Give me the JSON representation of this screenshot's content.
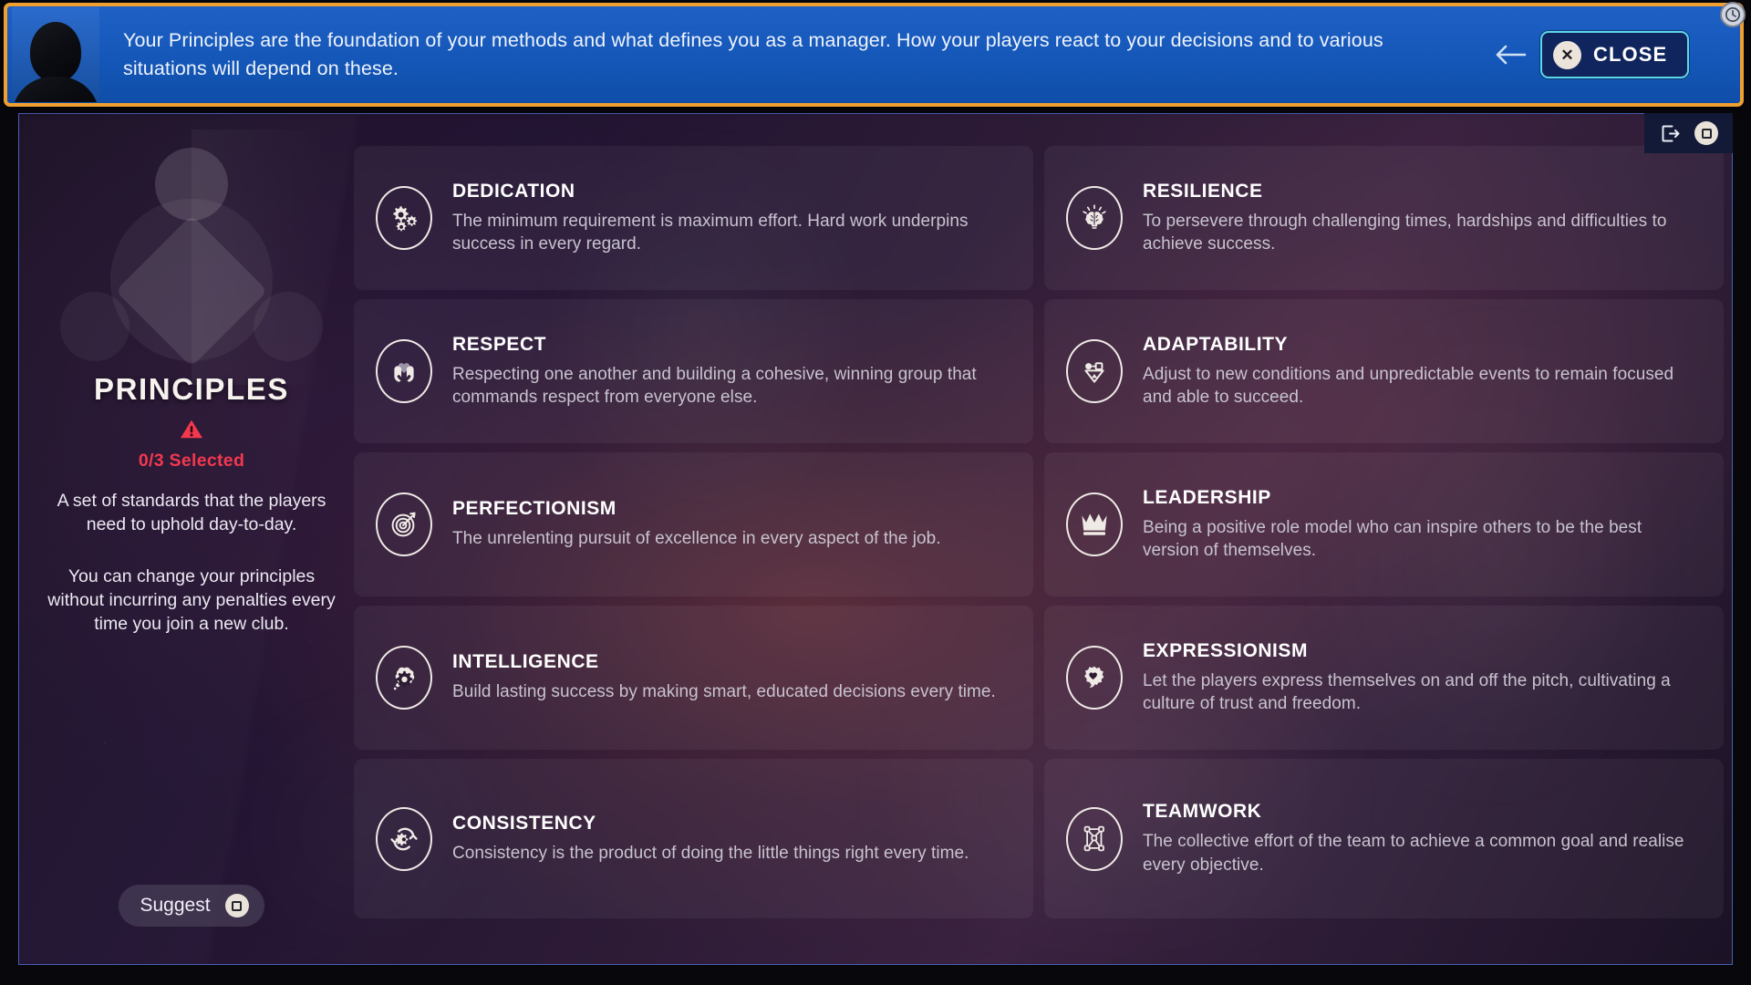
{
  "banner": {
    "message": "Your Principles are the foundation of your methods and what defines you as a manager. How your players react to your decisions and to various situations will depend on these.",
    "back_label": "Back",
    "close_label": "CLOSE",
    "avatar_name": "manager-avatar",
    "clock_icon": "clock-icon"
  },
  "hud": {
    "exit_icon": "exit-icon",
    "button_hint": "square-button-hint"
  },
  "panel": {
    "title": "PRINCIPLES",
    "warning_icon": "warning-triangle-icon",
    "selected_count": "0/3 Selected",
    "description_1": "A set of standards that the players need to uphold day-to-day.",
    "description_2": "You can change your principles without incurring any penalties every time you join a new club.",
    "suggest_label": "Suggest"
  },
  "colors": {
    "accent_orange": "#f0a030",
    "banner_blue": "#1558ba",
    "close_border": "#5fd6e8",
    "warning_red": "#f2384f",
    "frame_border": "#4a5fb5"
  },
  "principles": [
    {
      "name": "DEDICATION",
      "description": "The minimum requirement is maximum effort. Hard work underpins success in every regard.",
      "icon": "gears-icon"
    },
    {
      "name": "RESILIENCE",
      "description": "To persevere through challenging times, hardships and difficulties to achieve success.",
      "icon": "brain-rays-icon"
    },
    {
      "name": "RESPECT",
      "description": "Respecting one another and building a cohesive, winning group that commands respect from everyone else.",
      "icon": "hands-heart-icon"
    },
    {
      "name": "ADAPTABILITY",
      "description": "Adjust to new conditions and unpredictable events to remain focused and able to succeed.",
      "icon": "shapes-icon"
    },
    {
      "name": "PERFECTIONISM",
      "description": "The unrelenting pursuit of excellence in every aspect of the job.",
      "icon": "target-arrow-icon"
    },
    {
      "name": "LEADERSHIP",
      "description": "Being a positive role model who can inspire others to be the best version of themselves.",
      "icon": "crown-icon"
    },
    {
      "name": "INTELLIGENCE",
      "description": "Build lasting success by making smart, educated decisions every time.",
      "icon": "thought-gear-icon"
    },
    {
      "name": "EXPRESSIONISM",
      "description": "Let the players express themselves on and off the pitch, cultivating a culture of trust and freedom.",
      "icon": "splash-heart-icon"
    },
    {
      "name": "CONSISTENCY",
      "description": "Consistency is the product of doing the little things right every time.",
      "icon": "cycle-gear-icon"
    },
    {
      "name": "TEAMWORK",
      "description": "The collective effort of the team to achieve a common goal and realise every objective.",
      "icon": "formation-network-icon"
    }
  ]
}
